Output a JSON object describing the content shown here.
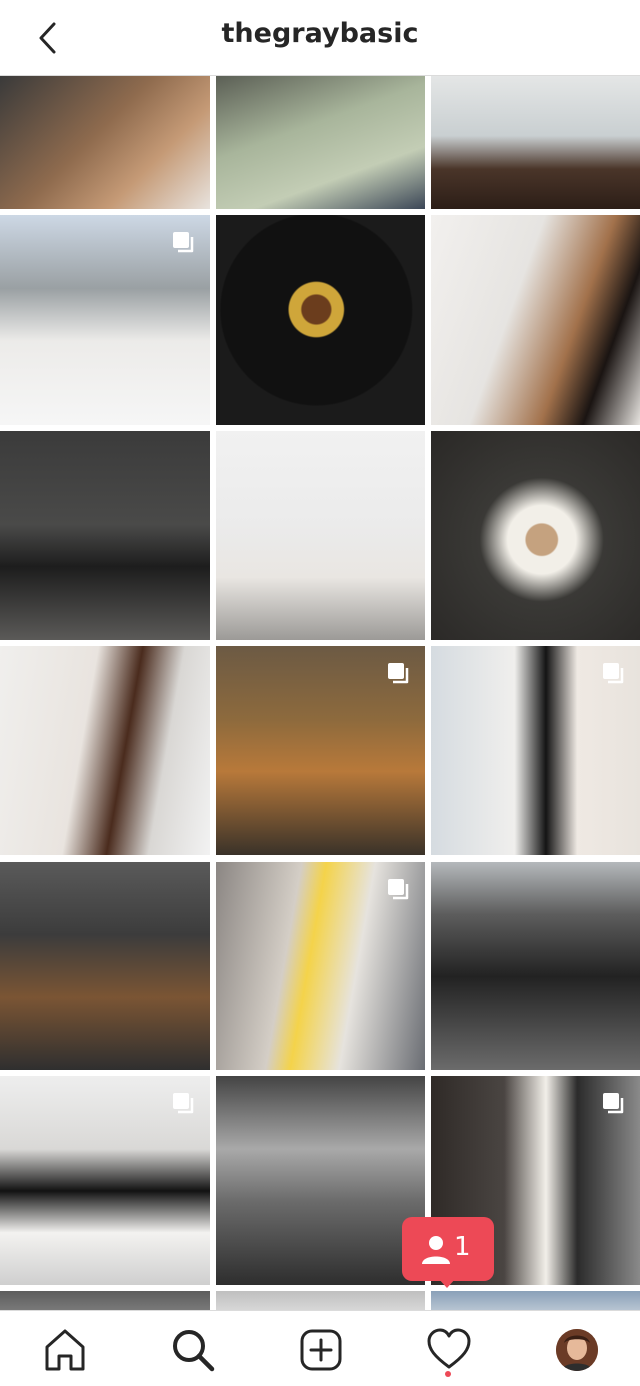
{
  "header": {
    "title": "thegraybasic"
  },
  "notification": {
    "count": "1"
  },
  "tiles": [
    {
      "name": "post-feet-coat",
      "bg": "linear-gradient(135deg,#3a3a3a 0%,#8f6b4e 45%,#c59a76 70%,#e8e3de 100%)",
      "multi": false
    },
    {
      "name": "post-green-top",
      "bg": "linear-gradient(160deg,#5b5f55 0%,#a8b59b 40%,#c3cdb5 70%,#3b4656 100%)",
      "multi": false
    },
    {
      "name": "post-dining-room",
      "bg": "linear-gradient(180deg,#e4e6e6 0%,#c9cfd1 45%,#4a3529 70%,#2c1e17 100%)",
      "multi": false
    },
    {
      "name": "post-snow-coat",
      "bg": "linear-gradient(180deg,#cdd8e5 0%,#9aa0a3 35%,#ecebe9 60%,#f6f6f6 100%)",
      "multi": true
    },
    {
      "name": "post-dessert-plate",
      "bg": "radial-gradient(circle at 48% 45%,#6b3d1d 0 9%,#cfa63a 10% 17%,#111 18% 60%,#1b1b1b 61%)",
      "multi": false
    },
    {
      "name": "post-flowers-woman",
      "bg": "linear-gradient(110deg,#f2f0ee 0%,#e6e4e1 40%,#a2714b 65%,#1a1412 80%,#e7e4e0 100%)",
      "multi": false
    },
    {
      "name": "post-dark-interior",
      "bg": "linear-gradient(180deg,#3b3b3b 0%,#4a4a49 45%,#1d1d1d 65%,#5b5a58 100%)",
      "multi": false
    },
    {
      "name": "post-yellow-flowers",
      "bg": "linear-gradient(180deg,#f1f1f1 0%,#ebebeb 45%,#e9e6e2 70%,#9c9a97 100%)",
      "multi": false
    },
    {
      "name": "post-coffee-book",
      "bg": "radial-gradient(circle at 53% 52%,#c5a27f 0 10%,#f2efe8 11% 22%,#3a3936 40%,#2a2826 100%)",
      "multi": false
    },
    {
      "name": "post-cream-dress",
      "bg": "linear-gradient(100deg,#f0efed 0%,#e9e4df 40%,#4a2b1d 58%,#d9d7d4 75%,#f2f2f2 100%)",
      "multi": false
    },
    {
      "name": "post-camel-jacket",
      "bg": "linear-gradient(180deg,#6c5a44 0%,#8d6a3d 35%,#b8793a 60%,#3a3229 100%)",
      "multi": true
    },
    {
      "name": "post-dog-sweater",
      "bg": "linear-gradient(90deg,#d5dbe0 0%,#f0efed 40%,#141414 55%,#efe9e3 70%,#e8e3dd 100%)",
      "multi": true
    },
    {
      "name": "post-bubble-tea",
      "bg": "linear-gradient(180deg,#5a5a5a 0%,#3c3c3c 35%,#7b5534 65%,#2f2f2f 100%)",
      "multi": false
    },
    {
      "name": "post-yellow-bear",
      "bg": "linear-gradient(100deg,#8b8683 0%,#d4cec6 35%,#f4d34a 45%,#e6e3de 65%,#6a6d73 100%)",
      "multi": true
    },
    {
      "name": "post-populace-cafe",
      "bg": "linear-gradient(180deg,#b5b9bc 0%,#5d5d5d 25%,#222 55%,#6b6b6b 100%)",
      "multi": false
    },
    {
      "name": "post-dog-couch",
      "bg": "linear-gradient(180deg,#eeeeee 0%,#d9d8d6 35%,#121212 55%,#f3f2f0 75%,#cfcfcf 100%)",
      "multi": true
    },
    {
      "name": "post-pumpkins",
      "bg": "linear-gradient(180deg,#444 0%,#a9a9a9 35%,#6b6b6b 60%,#2e2e2e 100%)",
      "multi": false
    },
    {
      "name": "post-black-skirt",
      "bg": "linear-gradient(90deg,#2f2a27 0%,#4a4542 35%,#f2efe9 55%,#2b2b2b 70%,#8a8a8a 100%)",
      "multi": true
    },
    {
      "name": "post-partial-1",
      "bg": "linear-gradient(180deg,#5d5d5d 0%,#7a7a7a 100%)",
      "multi": false
    },
    {
      "name": "post-partial-2",
      "bg": "linear-gradient(180deg,#bfbfbf 0%,#d8d8d8 100%)",
      "multi": false
    },
    {
      "name": "post-partial-3",
      "bg": "linear-gradient(180deg,#8aa0b8 0%,#b9c6d3 100%)",
      "multi": false
    }
  ],
  "icons": {
    "back": "back-arrow-icon",
    "home": "home-icon",
    "search": "search-icon",
    "add": "add-post-icon",
    "activity": "heart-icon",
    "profile": "profile-avatar"
  },
  "colors": {
    "accent": "#ed4956",
    "text": "#262626",
    "divider": "#dbdbdb"
  }
}
